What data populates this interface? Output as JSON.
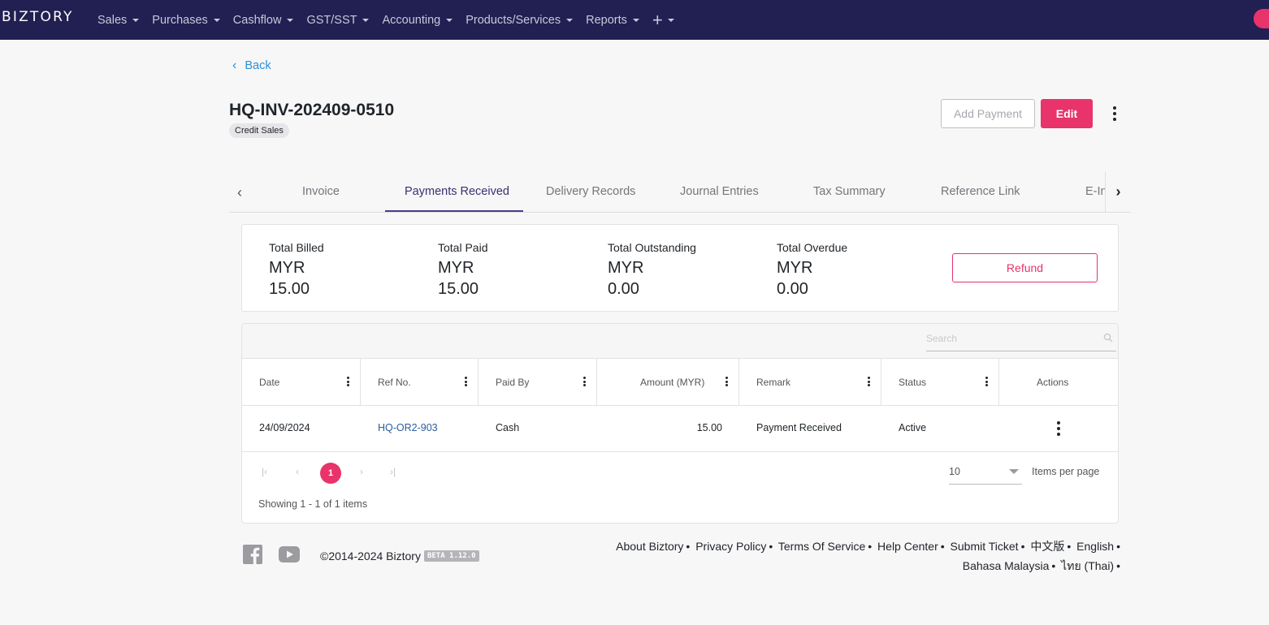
{
  "nav": {
    "logo": "BIZTORY",
    "items": [
      "Sales",
      "Purchases",
      "Cashflow",
      "GST/SST",
      "Accounting",
      "Products/Services",
      "Reports"
    ],
    "plus": "+"
  },
  "header": {
    "back": "Back",
    "title": "HQ-INV-202409-0510",
    "badge": "Credit Sales",
    "add_payment": "Add Payment",
    "edit": "Edit"
  },
  "tabs": [
    "Invoice",
    "Payments Received",
    "Delivery Records",
    "Journal Entries",
    "Tax Summary",
    "Reference Link",
    "E-In"
  ],
  "active_tab": "Payments Received",
  "summary": {
    "total_billed_label": "Total Billed",
    "total_billed_currency": "MYR",
    "total_billed_value": "15.00",
    "total_paid_label": "Total Paid",
    "total_paid_currency": "MYR",
    "total_paid_value": "15.00",
    "total_outstanding_label": "Total Outstanding",
    "total_outstanding_currency": "MYR",
    "total_outstanding_value": "0.00",
    "total_overdue_label": "Total Overdue",
    "total_overdue_currency": "MYR",
    "total_overdue_value": "0.00",
    "refund": "Refund"
  },
  "grid": {
    "search_placeholder": "Search",
    "columns": [
      "Date",
      "Ref No.",
      "Paid By",
      "Amount (MYR)",
      "Remark",
      "Status",
      "Actions"
    ],
    "rows": [
      {
        "date": "24/09/2024",
        "ref": "HQ-OR2-903",
        "paid_by": "Cash",
        "amount": "15.00",
        "remark": "Payment Received",
        "status": "Active"
      }
    ],
    "current_page": "1",
    "page_size": "10",
    "items_per_page": "Items per page",
    "showing": "Showing 1 - 1 of 1 items"
  },
  "footer": {
    "copyright": "©2014-2024 Biztory",
    "beta": "BETA 1.12.0",
    "links": [
      "About Biztory",
      "Privacy Policy",
      "Terms Of Service",
      "Help Center",
      "Submit Ticket",
      "中文版",
      "English",
      "Bahasa Malaysia",
      "ไทย (Thai)"
    ]
  },
  "colors": {
    "navbar": "#221f52",
    "accent": "#e8336b",
    "link": "#2d8fd5"
  }
}
